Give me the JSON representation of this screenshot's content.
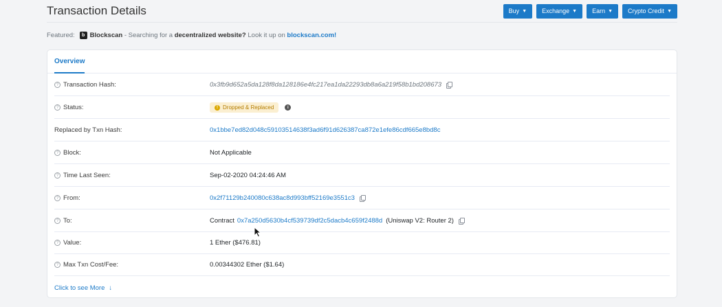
{
  "header": {
    "title": "Transaction Details",
    "buttons": [
      "Buy",
      "Exchange",
      "Earn",
      "Crypto Credit"
    ]
  },
  "featured": {
    "prefix": "Featured:",
    "brand": "Blockscan",
    "text_1": " - Searching for a ",
    "bold": "decentralized website?",
    "text_2": " Look it up on ",
    "link": "blockscan.com!"
  },
  "tabs": {
    "overview": "Overview"
  },
  "rows": {
    "tx_hash": {
      "label": "Transaction Hash:",
      "value": "0x3fb9d652a5da128f8da128186e4fc217ea1da22293db8a6a219f58b1bd208673"
    },
    "status": {
      "label": "Status:",
      "value": "Dropped & Replaced"
    },
    "replaced": {
      "label": "Replaced by Txn Hash:",
      "value": "0x1bbe7ed82d048c59103514638f3ad6f91d626387ca872e1efe86cdf665e8bd8c"
    },
    "block": {
      "label": "Block:",
      "value": "Not Applicable"
    },
    "time": {
      "label": "Time Last Seen:",
      "value": "Sep-02-2020 04:24:46 AM"
    },
    "from": {
      "label": "From:",
      "value": "0x2f71129b240080c638ac8d993bff52169e3551c3"
    },
    "to": {
      "label": "To:",
      "prefix": "Contract",
      "value": "0x7a250d5630b4cf539739df2c5dacb4c659f2488d",
      "suffix": "(Uniswap V2: Router 2)"
    },
    "value": {
      "label": "Value:",
      "value": "1 Ether ($476.81)"
    },
    "fee": {
      "label": "Max Txn Cost/Fee:",
      "value": "0.00344302 Ether ($1.64)"
    }
  },
  "more": {
    "label": "Click to see More",
    "arrow": "↓"
  },
  "colors": {
    "accent": "#1c7ac8",
    "badge_bg": "#fbefd1",
    "badge_text": "#b47d00"
  }
}
